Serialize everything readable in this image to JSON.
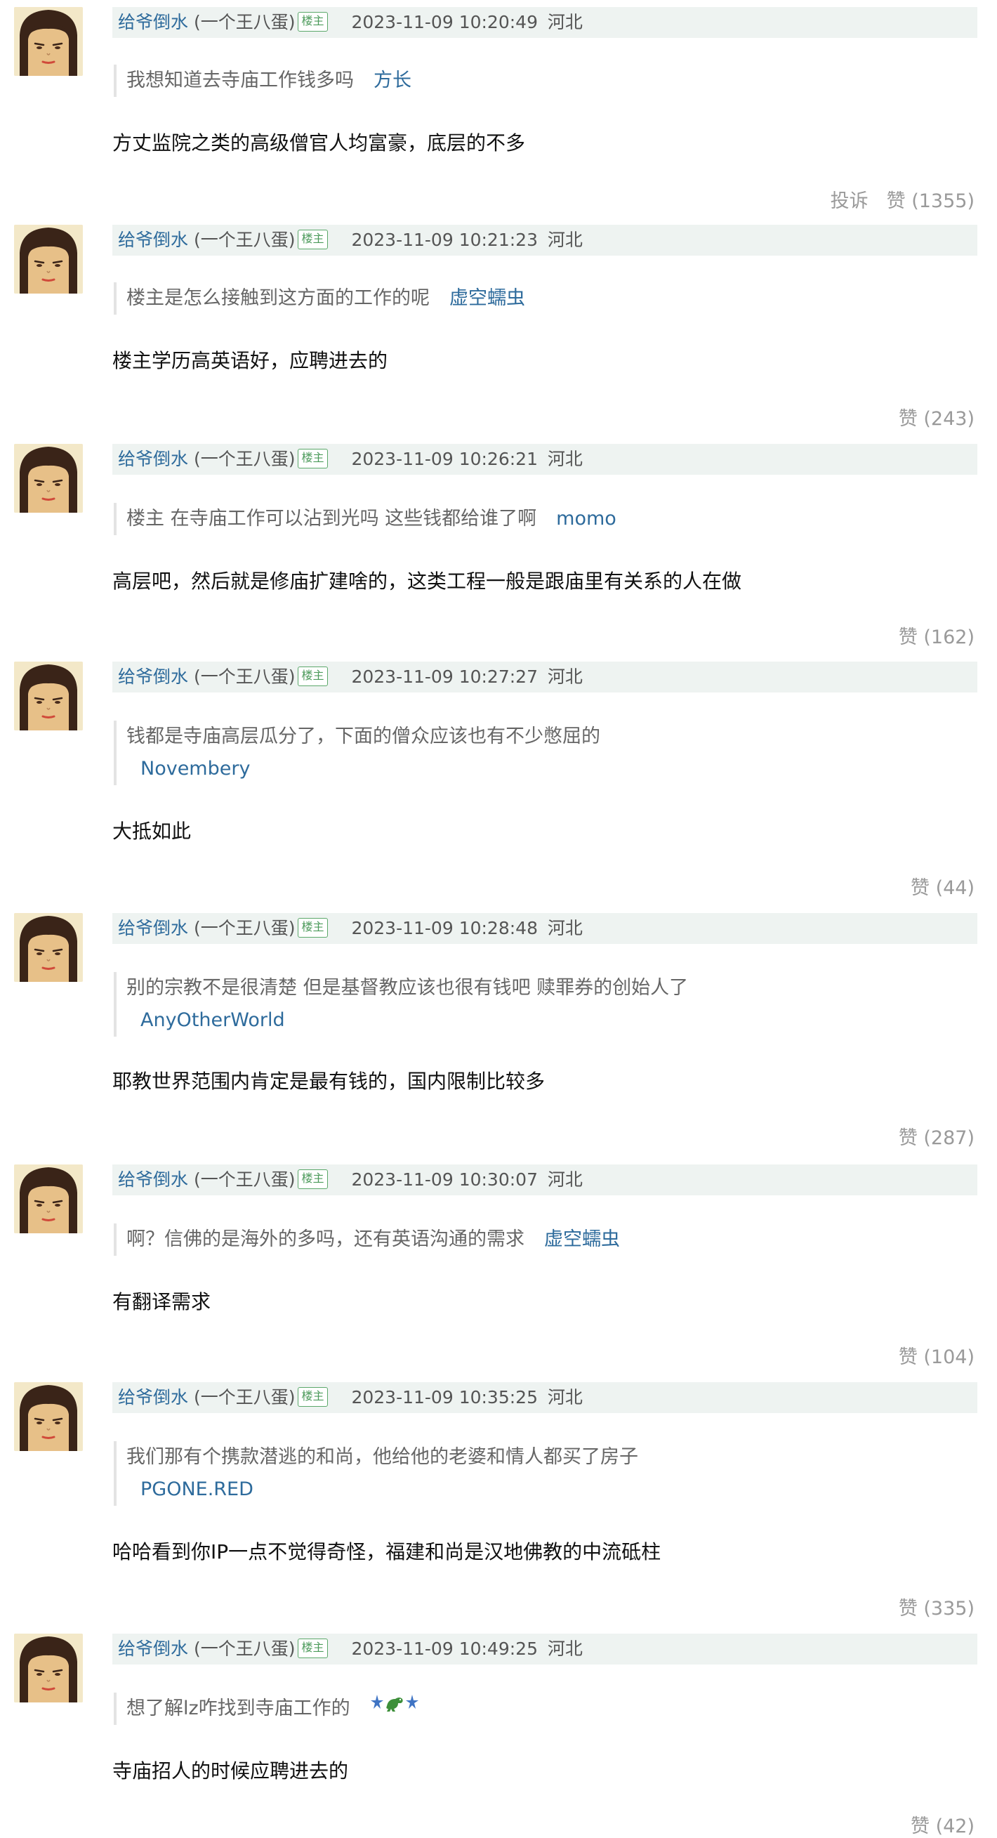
{
  "colors": {
    "author_link": "#2e6b9c",
    "meta_bg": "#eef3f1",
    "badge_green": "#5ba86a",
    "muted": "#9a9a9a"
  },
  "comments": [
    {
      "author": "给爷倒水",
      "nickname": "(一个王八蛋)",
      "badge": "楼主",
      "time": "2023-11-09 10:20:49",
      "location": "河北",
      "quote_text": "我想知道去寺庙工作钱多吗",
      "quote_author": "方长",
      "body": "方丈监院之类的高级僧官人均富豪，底层的不多",
      "report": "投诉",
      "likes": "赞 (1355)"
    },
    {
      "author": "给爷倒水",
      "nickname": "(一个王八蛋)",
      "badge": "楼主",
      "time": "2023-11-09 10:21:23",
      "location": "河北",
      "quote_text": "楼主是怎么接触到这方面的工作的呢",
      "quote_author": "虚空蠕虫",
      "body": "楼主学历高英语好，应聘进去的",
      "likes": "赞 (243)"
    },
    {
      "author": "给爷倒水",
      "nickname": "(一个王八蛋)",
      "badge": "楼主",
      "time": "2023-11-09 10:26:21",
      "location": "河北",
      "quote_text": "楼主 在寺庙工作可以沾到光吗 这些钱都给谁了啊",
      "quote_author": "momo",
      "body": "高层吧，然后就是修庙扩建啥的，这类工程一般是跟庙里有关系的人在做",
      "likes": "赞 (162)"
    },
    {
      "author": "给爷倒水",
      "nickname": "(一个王八蛋)",
      "badge": "楼主",
      "time": "2023-11-09 10:27:27",
      "location": "河北",
      "quote_text": "钱都是寺庙高层瓜分了，下面的僧众应该也有不少憋屈的",
      "quote_author": "Novembery",
      "body": "大抵如此",
      "likes": "赞 (44)"
    },
    {
      "author": "给爷倒水",
      "nickname": "(一个王八蛋)",
      "badge": "楼主",
      "time": "2023-11-09 10:28:48",
      "location": "河北",
      "quote_text": "别的宗教不是很清楚 但是基督教应该也很有钱吧 赎罪券的创始人了",
      "quote_author": "AnyOtherWorld",
      "body": "耶教世界范围内肯定是最有钱的，国内限制比较多",
      "likes": "赞 (287)"
    },
    {
      "author": "给爷倒水",
      "nickname": "(一个王八蛋)",
      "badge": "楼主",
      "time": "2023-11-09 10:30:07",
      "location": "河北",
      "quote_text": "啊？信佛的是海外的多吗，还有英语沟通的需求",
      "quote_author": "虚空蠕虫",
      "body": "有翻译需求",
      "likes": "赞 (104)"
    },
    {
      "author": "给爷倒水",
      "nickname": "(一个王八蛋)",
      "badge": "楼主",
      "time": "2023-11-09 10:35:25",
      "location": "河北",
      "quote_text": "我们那有个携款潜逃的和尚，他给他的老婆和情人都买了房子",
      "quote_author": "PGONE.RED",
      "body": "哈哈看到你IP一点不觉得奇怪，福建和尚是汉地佛教的中流砥柱",
      "likes": "赞 (335)"
    },
    {
      "author": "给爷倒水",
      "nickname": "(一个王八蛋)",
      "badge": "楼主",
      "time": "2023-11-09 10:49:25",
      "location": "河北",
      "quote_text": "想了解lz咋找到寺庙工作的",
      "quote_author_icon": "sparkle-dinosaur-sparkle-icon",
      "body": "寺庙招人的时候应聘进去的",
      "likes": "赞 (42)"
    }
  ]
}
